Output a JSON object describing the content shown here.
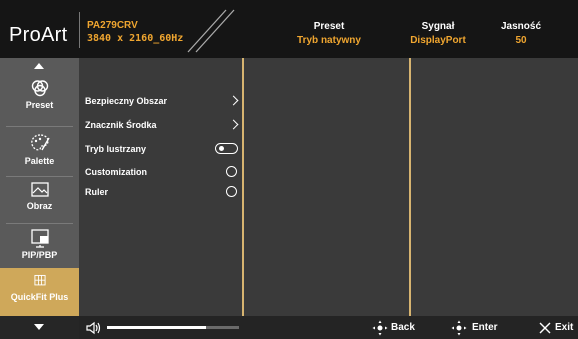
{
  "header": {
    "brand": "ProArt",
    "model": "PA279CRV",
    "resolution": "3840 x 2160_60Hz",
    "preset_label": "Preset",
    "preset_value": "Tryb natywny",
    "signal_label": "Sygnał",
    "signal_value": "DisplayPort",
    "brightness_label": "Jasność",
    "brightness_value": "50"
  },
  "sidebar": {
    "items": [
      {
        "label": "Preset",
        "icon": "preset-icon"
      },
      {
        "label": "Palette",
        "icon": "palette-icon"
      },
      {
        "label": "Obraz",
        "icon": "image-icon"
      },
      {
        "label": "PIP/PBP",
        "icon": "pip-icon"
      },
      {
        "label": "QuickFit Plus",
        "icon": "grid-icon"
      }
    ],
    "active": "QuickFit Plus"
  },
  "menu": {
    "items": [
      {
        "label": "Bezpieczny Obszar",
        "control": "chevron"
      },
      {
        "label": "Znacznik Środka",
        "control": "chevron"
      },
      {
        "label": "Tryb lustrzany",
        "control": "toggle",
        "state": "off"
      },
      {
        "label": "Customization",
        "control": "radio",
        "selected": false
      },
      {
        "label": "Ruler",
        "control": "radio",
        "selected": false
      }
    ]
  },
  "footer": {
    "volume_level": 0.75,
    "back_label": "Back",
    "enter_label": "Enter",
    "exit_label": "Exit"
  },
  "colors": {
    "accent": "#f0a630",
    "active_tab": "#cfa85a",
    "divider": "#d7b470"
  }
}
